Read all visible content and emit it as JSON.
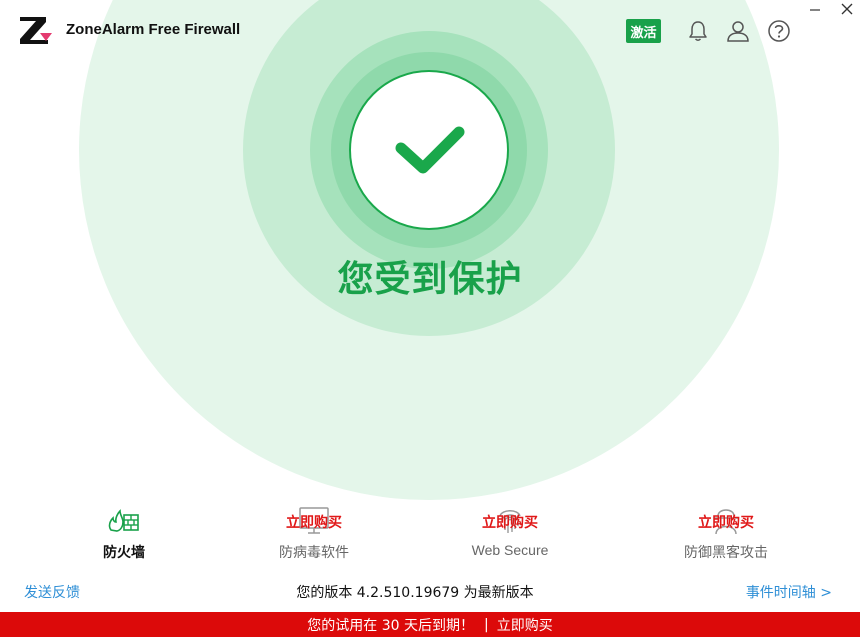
{
  "header": {
    "app_title": "ZoneAlarm Free Firewall",
    "activate_label": "激活",
    "icons": [
      "bell-icon",
      "user-icon",
      "help-icon"
    ]
  },
  "status": {
    "text": "您受到保护",
    "icon": "checkmark-icon",
    "color": "#19a14a"
  },
  "features": [
    {
      "label": "防火墙",
      "buy": "",
      "icon": "firewall-icon",
      "active": true
    },
    {
      "label": "防病毒软件",
      "buy": "立即购买",
      "icon": "monitor-icon",
      "active": false
    },
    {
      "label": "Web Secure",
      "buy": "立即购买",
      "icon": "fingerprint-icon",
      "active": false
    },
    {
      "label": "防御黑客攻击",
      "buy": "立即购买",
      "icon": "hacker-icon",
      "active": false
    }
  ],
  "footer": {
    "feedback": "发送反馈",
    "version": "您的版本 4.2.510.19679 为最新版本",
    "timeline": "事件时间轴 >"
  },
  "trial": {
    "message": "您的试用在 30 天后到期！",
    "separator": "|",
    "buy": "立即购买",
    "color": "#dc0a0a"
  }
}
